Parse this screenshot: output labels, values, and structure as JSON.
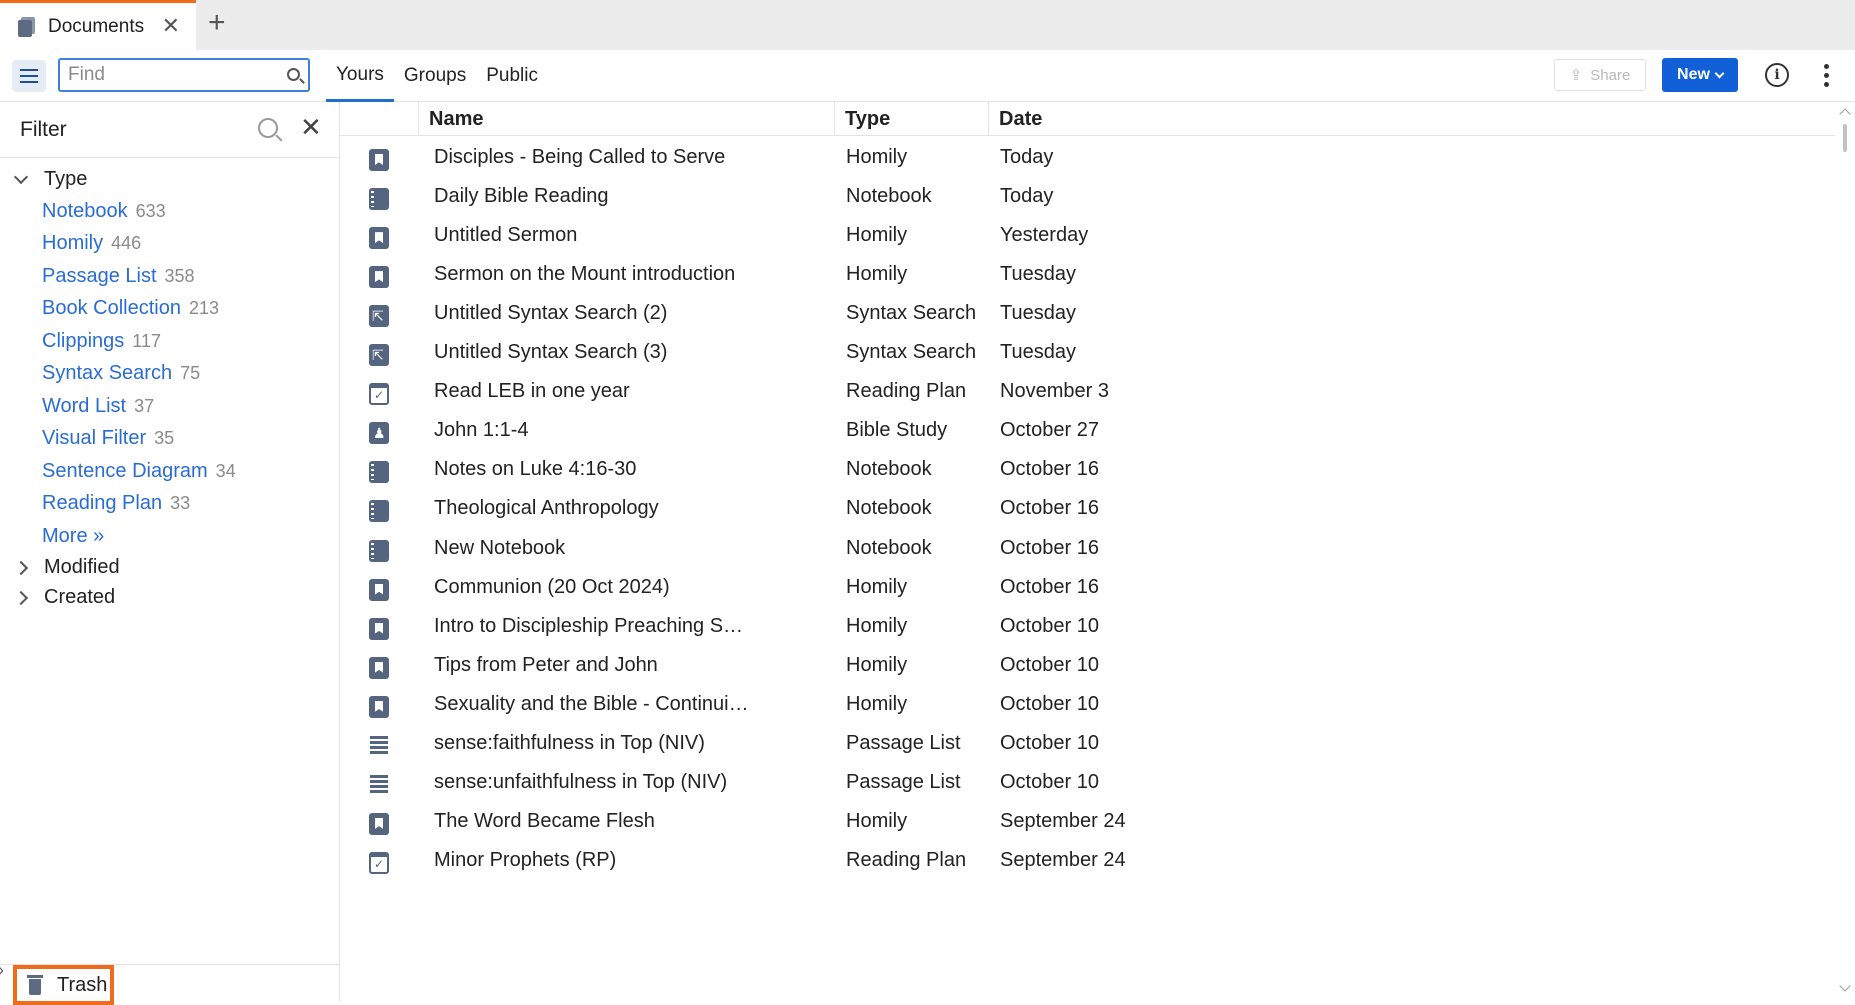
{
  "tab": {
    "title": "Documents"
  },
  "search": {
    "placeholder": "Find"
  },
  "scope_tabs": [
    "Yours",
    "Groups",
    "Public"
  ],
  "toolbar": {
    "share_label": "Share",
    "new_label": "New",
    "info_icon": "info-icon"
  },
  "filter": {
    "title": "Filter",
    "type_group": "Type",
    "items": [
      {
        "label": "Notebook",
        "count": "633"
      },
      {
        "label": "Homily",
        "count": "446"
      },
      {
        "label": "Passage List",
        "count": "358"
      },
      {
        "label": "Book Collection",
        "count": "213"
      },
      {
        "label": "Clippings",
        "count": "117"
      },
      {
        "label": "Syntax Search",
        "count": "75"
      },
      {
        "label": "Word List",
        "count": "37"
      },
      {
        "label": "Visual Filter",
        "count": "35"
      },
      {
        "label": "Sentence Diagram",
        "count": "34"
      },
      {
        "label": "Reading Plan",
        "count": "33"
      }
    ],
    "more": "More »",
    "modified": "Modified",
    "created": "Created"
  },
  "trash": {
    "label": "Trash"
  },
  "columns": {
    "name": "Name",
    "type": "Type",
    "date": "Date"
  },
  "documents": [
    {
      "name": "Disciples - Being Called to Serve",
      "type": "Homily",
      "date": "Today",
      "icon": "homily"
    },
    {
      "name": "Daily Bible Reading",
      "type": "Notebook",
      "date": "Today",
      "icon": "notebook"
    },
    {
      "name": "Untitled Sermon",
      "type": "Homily",
      "date": "Yesterday",
      "icon": "homily"
    },
    {
      "name": "Sermon on the Mount introduction",
      "type": "Homily",
      "date": "Tuesday",
      "icon": "homily"
    },
    {
      "name": "Untitled Syntax Search (2)",
      "type": "Syntax Search",
      "date": "Tuesday",
      "icon": "syntax"
    },
    {
      "name": "Untitled Syntax Search (3)",
      "type": "Syntax Search",
      "date": "Tuesday",
      "icon": "syntax"
    },
    {
      "name": "Read LEB in one year",
      "type": "Reading Plan",
      "date": "November 3",
      "icon": "reading"
    },
    {
      "name": "John 1:1-4",
      "type": "Bible Study",
      "date": "October 27",
      "icon": "study"
    },
    {
      "name": "Notes on Luke 4:16-30",
      "type": "Notebook",
      "date": "October 16",
      "icon": "notebook"
    },
    {
      "name": "Theological Anthropology",
      "type": "Notebook",
      "date": "October 16",
      "icon": "notebook"
    },
    {
      "name": "New Notebook",
      "type": "Notebook",
      "date": "October 16",
      "icon": "notebook"
    },
    {
      "name": "Communion (20 Oct 2024)",
      "type": "Homily",
      "date": "October 16",
      "icon": "homily"
    },
    {
      "name": "Intro to Discipleship Preaching Series",
      "type": "Homily",
      "date": "October 10",
      "icon": "homily"
    },
    {
      "name": "Tips from Peter and John",
      "type": "Homily",
      "date": "October 10",
      "icon": "homily"
    },
    {
      "name": "Sexuality and the Bible - Continuing the…",
      "type": "Homily",
      "date": "October 10",
      "icon": "homily"
    },
    {
      "name": "sense:faithfulness in Top (NIV)",
      "type": "Passage List",
      "date": "October 10",
      "icon": "passage"
    },
    {
      "name": "sense:unfaithfulness in Top (NIV)",
      "type": "Passage List",
      "date": "October 10",
      "icon": "passage"
    },
    {
      "name": "The Word Became Flesh",
      "type": "Homily",
      "date": "September 24",
      "icon": "homily"
    },
    {
      "name": "Minor Prophets (RP)",
      "type": "Reading Plan",
      "date": "September 24",
      "icon": "reading"
    }
  ]
}
